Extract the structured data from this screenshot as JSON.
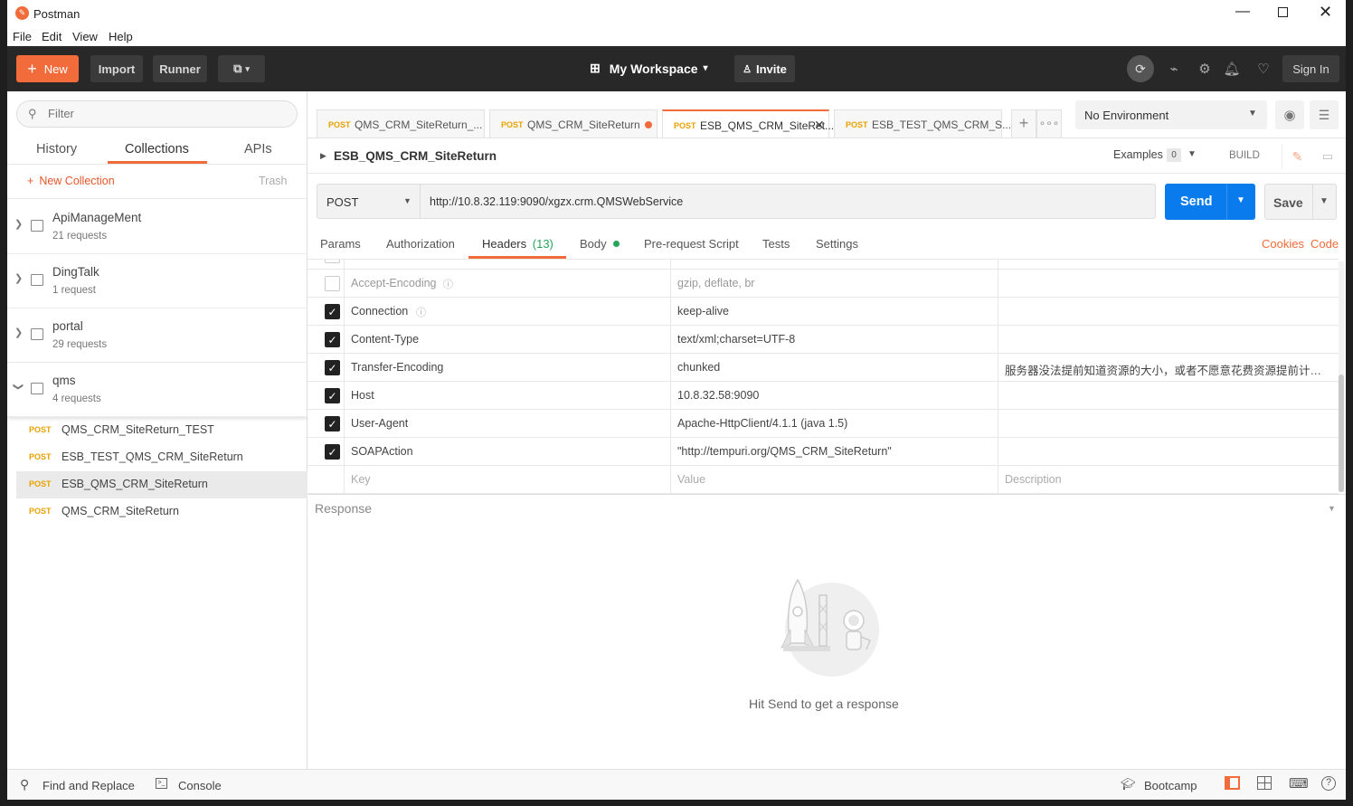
{
  "window": {
    "title": "Postman",
    "menu": [
      "File",
      "Edit",
      "View",
      "Help"
    ]
  },
  "header": {
    "new_label": "New",
    "import_label": "Import",
    "runner_label": "Runner",
    "workspace_label": "My Workspace",
    "invite_label": "Invite",
    "signin_label": "Sign In"
  },
  "sidebar": {
    "filter_placeholder": "Filter",
    "tabs": [
      "History",
      "Collections",
      "APIs"
    ],
    "new_collection_label": "New Collection",
    "trash_label": "Trash",
    "collections": [
      {
        "name": "ApiManageMent",
        "count": "21 requests"
      },
      {
        "name": "DingTalk",
        "count": "1 request"
      },
      {
        "name": "portal",
        "count": "29 requests"
      },
      {
        "name": "qms",
        "count": "4 requests"
      }
    ],
    "requests": [
      {
        "method": "POST",
        "name": "QMS_CRM_SiteReturn_TEST"
      },
      {
        "method": "POST",
        "name": "ESB_TEST_QMS_CRM_SiteReturn"
      },
      {
        "method": "POST",
        "name": "ESB_QMS_CRM_SiteReturn"
      },
      {
        "method": "POST",
        "name": "QMS_CRM_SiteReturn"
      }
    ]
  },
  "tabs": [
    {
      "method": "POST",
      "name": "QMS_CRM_SiteReturn_..."
    },
    {
      "method": "POST",
      "name": "QMS_CRM_SiteReturn"
    },
    {
      "method": "POST",
      "name": "ESB_QMS_CRM_SiteRet..."
    },
    {
      "method": "POST",
      "name": "ESB_TEST_QMS_CRM_S..."
    }
  ],
  "environment": "No Environment",
  "request": {
    "name": "ESB_QMS_CRM_SiteReturn",
    "examples_label": "Examples",
    "examples_count": "0",
    "build_label": "BUILD",
    "method": "POST",
    "url": "http://10.8.32.119:9090/xgzx.crm.QMSWebService",
    "send_label": "Send",
    "save_label": "Save"
  },
  "subtabs": {
    "params": "Params",
    "authorization": "Authorization",
    "headers": "Headers",
    "headers_count": "(13)",
    "body": "Body",
    "prerequest": "Pre-request Script",
    "tests": "Tests",
    "settings": "Settings",
    "cookies": "Cookies",
    "code": "Code"
  },
  "headers": [
    {
      "key": "Accept-Encoding",
      "value": "gzip, deflate, br",
      "description": "",
      "checked": false,
      "info": true
    },
    {
      "key": "Connection",
      "value": "keep-alive",
      "description": "",
      "checked": true,
      "info": true
    },
    {
      "key": "Content-Type",
      "value": "text/xml;charset=UTF-8",
      "description": "",
      "checked": true,
      "info": false
    },
    {
      "key": "Transfer-Encoding",
      "value": "chunked",
      "description": "服务器没法提前知道资源的大小，或者不愿意花费资源提前计算资...",
      "checked": true,
      "info": false
    },
    {
      "key": "Host",
      "value": "10.8.32.58:9090",
      "description": "",
      "checked": true,
      "info": false
    },
    {
      "key": "User-Agent",
      "value": "Apache-HttpClient/4.1.1 (java 1.5)",
      "description": "",
      "checked": true,
      "info": false
    },
    {
      "key": "SOAPAction",
      "value": "\"http://tempuri.org/QMS_CRM_SiteReturn\"",
      "description": "",
      "checked": true,
      "info": false
    }
  ],
  "new_row": {
    "key": "Key",
    "value": "Value",
    "description": "Description"
  },
  "response": {
    "label": "Response",
    "empty_text": "Hit Send to get a response"
  },
  "statusbar": {
    "find_replace": "Find and Replace",
    "console": "Console",
    "bootcamp": "Bootcamp"
  },
  "colors": {
    "accent": "#f26b3a",
    "send": "#097bed",
    "method_post": "#e8a200",
    "header_bg": "#282828"
  }
}
